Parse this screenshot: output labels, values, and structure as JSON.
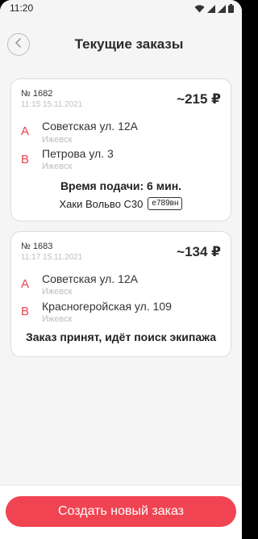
{
  "status_bar": {
    "time": "11:20"
  },
  "header": {
    "title": "Текущие заказы"
  },
  "orders": [
    {
      "number": "№ 1682",
      "created": "11:15 15.11.2021",
      "price": "~215 ₽",
      "points": [
        {
          "letter": "А",
          "address": "Советская ул. 12А",
          "city": "Ижевск"
        },
        {
          "letter": "В",
          "address": "Петрова ул. 3",
          "city": "Ижевск"
        }
      ],
      "pickup_time": "Время подачи: 6 мин.",
      "car_model": "Хаки Вольво С30",
      "plate": "е789вн"
    },
    {
      "number": "№ 1683",
      "created": "11:17 15.11.2021",
      "price": "~134 ₽",
      "points": [
        {
          "letter": "А",
          "address": "Советская ул. 12А",
          "city": "Ижевск"
        },
        {
          "letter": "В",
          "address": "Красногеройская ул. 109",
          "city": "Ижевск"
        }
      ],
      "status": "Заказ принят, идёт поиск экипажа"
    }
  ],
  "footer": {
    "create_button": "Создать новый заказ"
  },
  "colors": {
    "accent": "#f04452",
    "point_letter": "#e8424e",
    "muted": "#bdbdbd"
  },
  "icons": {
    "back": "chevron-left-icon",
    "wifi": "wifi-icon",
    "signal": "signal-icon",
    "battery": "battery-icon"
  }
}
